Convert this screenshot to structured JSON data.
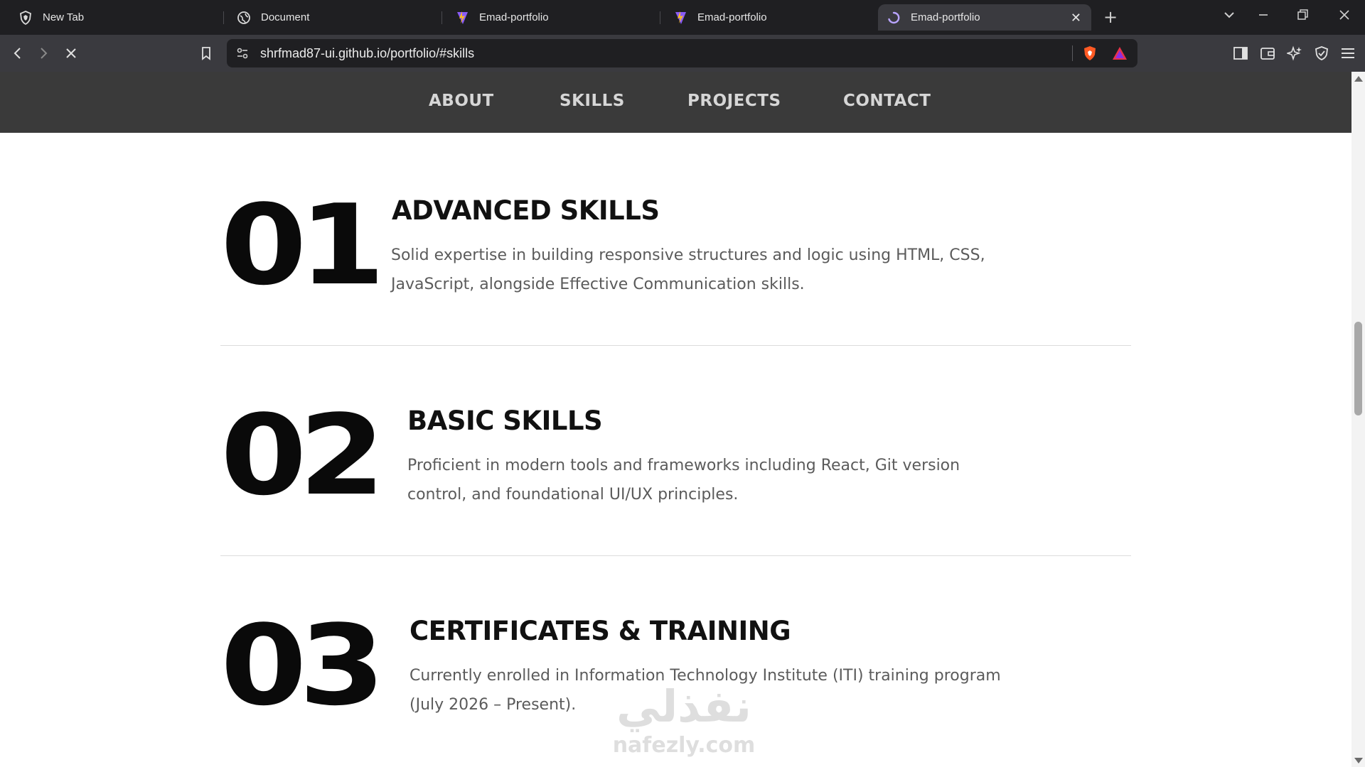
{
  "browser": {
    "tabs": [
      {
        "title": "New Tab",
        "icon": "brave-shield-icon",
        "active": false
      },
      {
        "title": "Document",
        "icon": "globe-icon",
        "active": false
      },
      {
        "title": "Emad-portfolio",
        "icon": "vite-logo-icon",
        "active": false
      },
      {
        "title": "Emad-portfolio",
        "icon": "vite-logo-icon",
        "active": false
      },
      {
        "title": "Emad-portfolio",
        "icon": "loading-spinner-icon",
        "active": true
      }
    ],
    "url": "shrfmad87-ui.github.io/portfolio/#skills",
    "accent_color": "#ff5a24"
  },
  "nav": {
    "items": [
      "ABOUT",
      "SKILLS",
      "PROJECTS",
      "CONTACT"
    ]
  },
  "skills": [
    {
      "number": "01",
      "title": "ADVANCED SKILLS",
      "line1": "Solid expertise in building responsive structures and logic using HTML, CSS,",
      "line2": "JavaScript, alongside Effective Communication skills."
    },
    {
      "number": "02",
      "title": "BASIC SKILLS",
      "line1": "Proficient in modern tools and frameworks including React, Git version",
      "line2": "control, and foundational UI/UX principles."
    },
    {
      "number": "03",
      "title": "CERTIFICATES & TRAINING",
      "line1": "Currently enrolled in Information Technology Institute (ITI) training program",
      "line2": "(July 2026 – Present)."
    }
  ],
  "watermark": {
    "arabic": "نفذلي",
    "latin": "nafezly.com"
  }
}
